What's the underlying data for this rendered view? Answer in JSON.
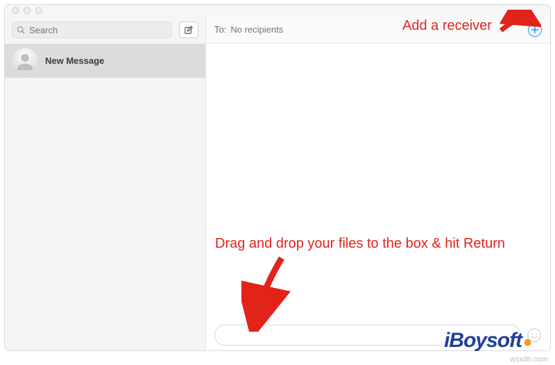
{
  "window": {
    "search_placeholder": "Search"
  },
  "sidebar": {
    "conversations": [
      {
        "title": "New Message"
      }
    ]
  },
  "compose": {
    "to_label": "To:",
    "to_placeholder": "No recipients",
    "message_placeholder": ""
  },
  "annotations": {
    "add_receiver": "Add a receiver",
    "drag_drop": "Drag and drop your files to the box & hit Return"
  },
  "branding": {
    "logo_text": "iBoysoft",
    "site": "wsxdn.com"
  }
}
